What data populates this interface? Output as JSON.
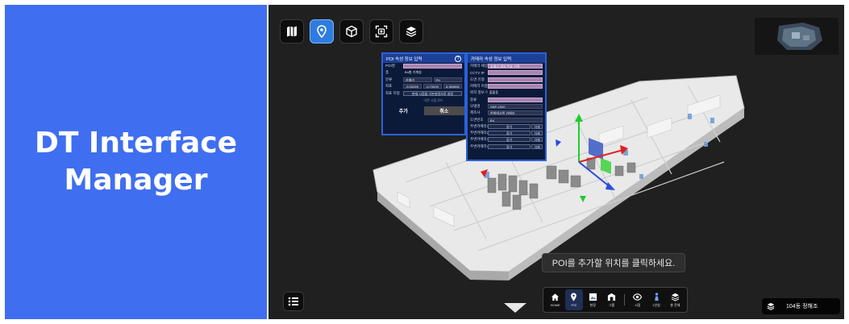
{
  "left_panel": {
    "title_line1": "DT Interface",
    "title_line2": "Manager"
  },
  "top_toolbar": {
    "buttons": [
      {
        "icon": "map-icon",
        "active": false
      },
      {
        "icon": "location-pin-icon",
        "active": true
      },
      {
        "icon": "cube-icon",
        "active": false
      },
      {
        "icon": "capture-icon",
        "active": false
      },
      {
        "icon": "layers-icon",
        "active": false
      }
    ]
  },
  "poi_dialog": {
    "title": "POI 속성 정보 입력",
    "help": "?",
    "rows": [
      {
        "label": "POI명",
        "value": ""
      },
      {
        "label": "층",
        "value": "B4층 기계실"
      },
      {
        "label": "분류",
        "value1": "카메라",
        "value2": "PH"
      },
      {
        "label": "좌표",
        "x": "-5.00289",
        "y": "-0.70000",
        "z": "8.389856"
      },
      {
        "label": "좌표 지정",
        "value": "현재 시점을 기본설정으로 설정",
        "sub": "이전 시점 로드"
      }
    ],
    "add_label": "추가",
    "cancel_label": "취소"
  },
  "camera_dialog": {
    "title": "카메라 속성 정보 입력",
    "rows": [
      {
        "label": "카메라 채널",
        "value": "카메라 채널 번호 선택",
        "style": "pink"
      },
      {
        "label": "CCTV IP",
        "value": "",
        "style": "pink"
      },
      {
        "label": "도면 유형",
        "value": "",
        "style": "pink"
      },
      {
        "label": "카메라 이름",
        "value": "",
        "style": "pink"
      },
      {
        "label": "위치 정보 이름",
        "value": "출출동",
        "style": "plain"
      },
      {
        "label": "종류",
        "value": "",
        "style": "pink"
      },
      {
        "label": "모델명",
        "value": "SNP-2320"
      },
      {
        "label": "제조사",
        "value": "한화테크윈 카메라"
      },
      {
        "label": "도면번호",
        "value": "B4"
      }
    ],
    "peripheral_rows": [
      {
        "label": "주변카메라1",
        "find": "찾기",
        "del": "삭제"
      },
      {
        "label": "주변카메라2",
        "find": "찾기",
        "del": "삭제"
      },
      {
        "label": "주변카메라3",
        "find": "찾기",
        "del": "삭제"
      },
      {
        "label": "주변카메라4",
        "find": "찾기",
        "del": "삭제"
      }
    ]
  },
  "toast": {
    "message": "POI를 추가할 위치를 클릭하세요."
  },
  "bottom_bar": {
    "items": [
      {
        "label": "HOME",
        "icon": "home-icon",
        "active": false
      },
      {
        "label": "POI",
        "icon": "poi-pin-icon",
        "active": true
      },
      {
        "label": "현장",
        "icon": "site-icon",
        "active": false
      },
      {
        "label": "그룹",
        "icon": "group-icon",
        "active": false
      },
      {
        "label": "시점",
        "icon": "eye-icon",
        "active": false
      },
      {
        "label": "1인칭",
        "icon": "person-icon",
        "active": false
      },
      {
        "label": "층 전체",
        "icon": "all-floors-icon",
        "active": false
      }
    ]
  },
  "building_selector": {
    "label": "104동 정해조",
    "icon": "layers-icon"
  },
  "colors": {
    "brand_blue": "#3f6ef0",
    "viewport_bg": "#202020",
    "dialog_border": "#2a62d9"
  }
}
